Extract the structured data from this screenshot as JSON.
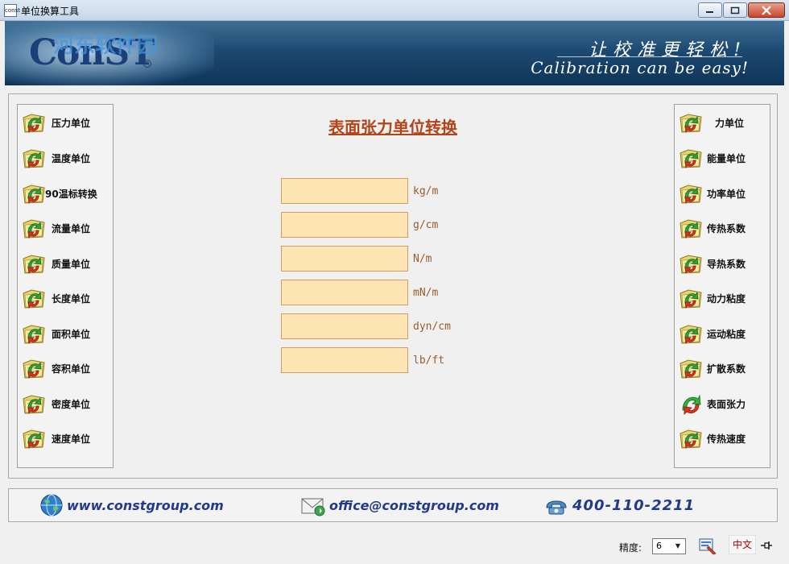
{
  "window": {
    "title": "单位换算工具",
    "icon_text": "const"
  },
  "banner": {
    "logo": "ConST",
    "watermark": "河东软件园",
    "slogan_cn": "让校准更轻松!",
    "slogan_en": "Calibration can be easy!"
  },
  "left_nav": [
    {
      "label": "压力单位",
      "icon": "folder-arrow-icon"
    },
    {
      "label": "温度单位",
      "icon": "folder-arrow-icon"
    },
    {
      "label": "90温标转换",
      "icon": "folder-arrow-icon"
    },
    {
      "label": "流量单位",
      "icon": "folder-arrow-icon"
    },
    {
      "label": "质量单位",
      "icon": "folder-arrow-icon"
    },
    {
      "label": "长度单位",
      "icon": "folder-arrow-icon"
    },
    {
      "label": "面积单位",
      "icon": "folder-arrow-icon"
    },
    {
      "label": "容积单位",
      "icon": "folder-arrow-icon"
    },
    {
      "label": "密度单位",
      "icon": "folder-arrow-icon"
    },
    {
      "label": "速度单位",
      "icon": "folder-arrow-icon"
    }
  ],
  "right_nav": [
    {
      "label": "力单位",
      "icon": "folder-arrow-icon"
    },
    {
      "label": "能量单位",
      "icon": "folder-arrow-icon"
    },
    {
      "label": "功率单位",
      "icon": "folder-arrow-icon"
    },
    {
      "label": "传热系数",
      "icon": "folder-arrow-icon"
    },
    {
      "label": "导热系数",
      "icon": "folder-arrow-icon"
    },
    {
      "label": "动力粘度",
      "icon": "folder-arrow-icon"
    },
    {
      "label": "运动粘度",
      "icon": "folder-arrow-icon"
    },
    {
      "label": "扩散系数",
      "icon": "folder-arrow-icon"
    },
    {
      "label": "表面张力",
      "icon": "green-red-arrow-icon",
      "active": true
    },
    {
      "label": "传热速度",
      "icon": "folder-arrow-icon"
    }
  ],
  "converter": {
    "title": "表面张力单位转换",
    "fields": [
      {
        "unit": "kg/m",
        "value": ""
      },
      {
        "unit": "g/cm",
        "value": ""
      },
      {
        "unit": "N/m",
        "value": ""
      },
      {
        "unit": "mN/m",
        "value": ""
      },
      {
        "unit": "dyn/cm",
        "value": ""
      },
      {
        "unit": "lb/ft",
        "value": ""
      }
    ]
  },
  "contact": {
    "website": "www.constgroup.com",
    "email": "office@constgroup.com",
    "phone": "400-110-2211"
  },
  "footer": {
    "precision_label": "精度:",
    "precision_value": "6",
    "language_label": "中文"
  },
  "colors": {
    "banner": "#1d4a72",
    "field_bg": "#fde5b3",
    "title": "#b2451a",
    "contact_text": "#213a8a"
  }
}
